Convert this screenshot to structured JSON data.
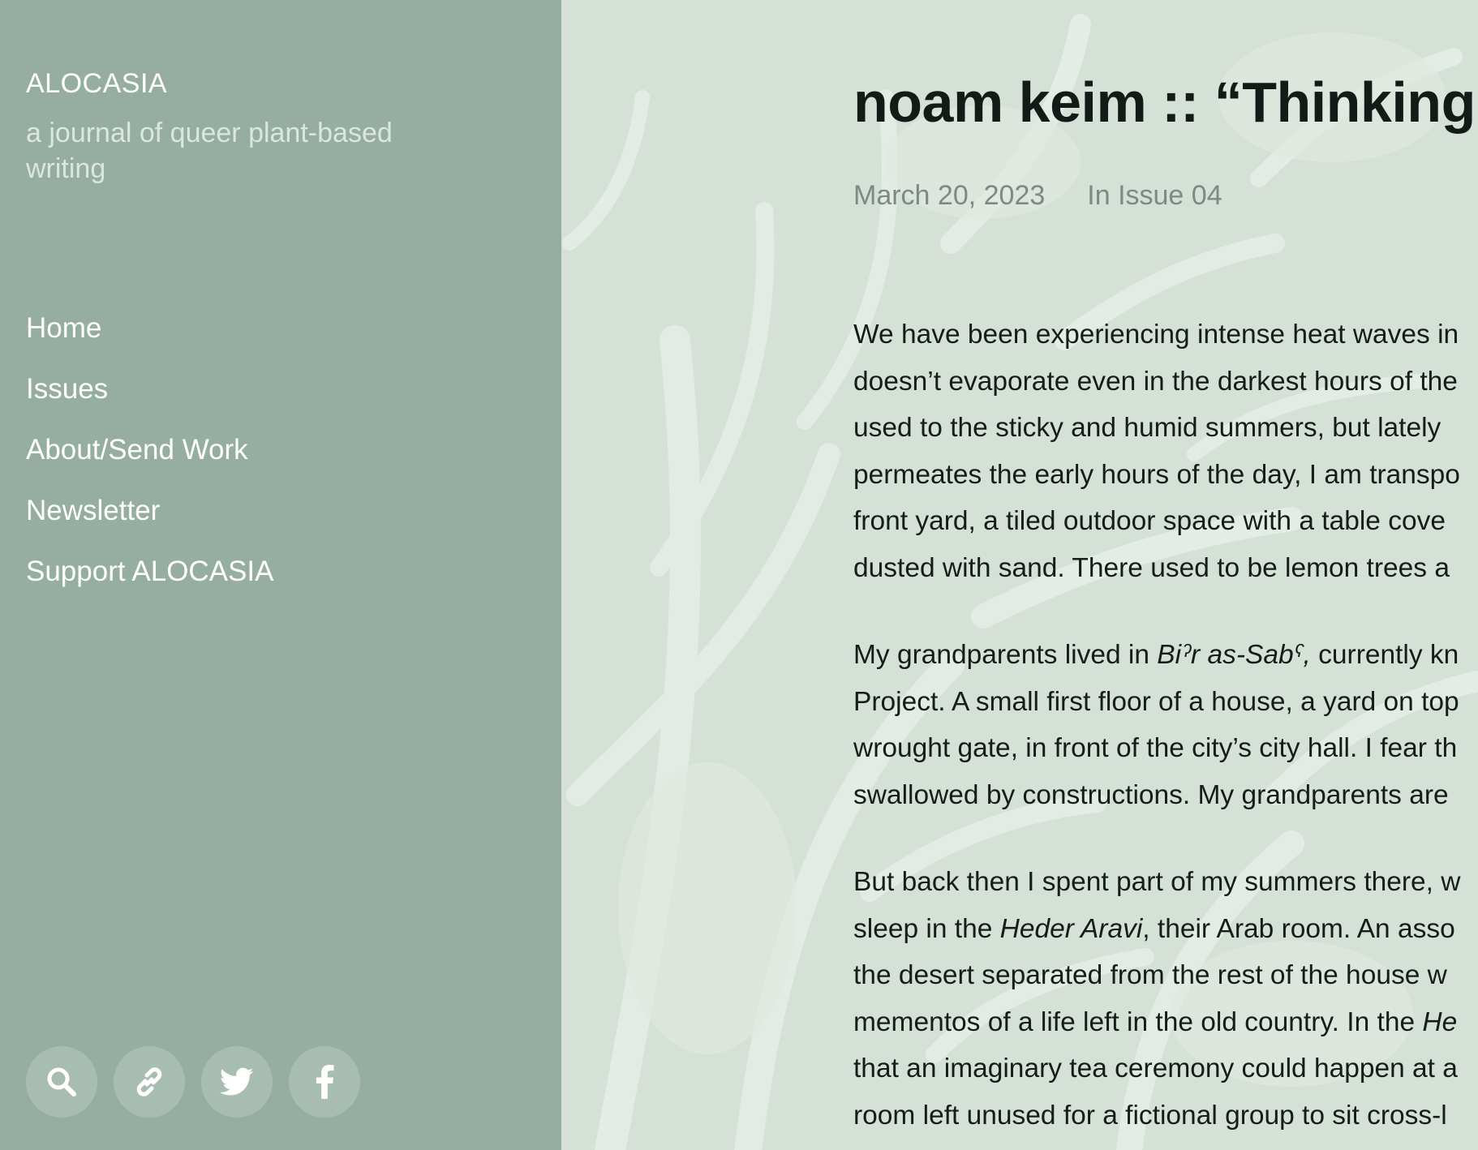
{
  "site": {
    "title": "ALOCASIA",
    "tagline": "a journal of queer plant-based writing"
  },
  "nav": {
    "items": [
      {
        "label": "Home"
      },
      {
        "label": "Issues"
      },
      {
        "label": "About/Send Work"
      },
      {
        "label": "Newsletter"
      },
      {
        "label": "Support ALOCASIA"
      }
    ]
  },
  "social": {
    "icons": [
      "search-icon",
      "link-icon",
      "twitter-icon",
      "facebook-icon"
    ]
  },
  "post": {
    "title": "noam keim :: “Thinking a",
    "date": "March 20, 2023",
    "issue": "In Issue 04",
    "p1": [
      "We have been experiencing intense heat waves in",
      "doesn’t evaporate even in the darkest hours of the",
      "used to the sticky and humid summers, but lately",
      "permeates the early hours of the day, I am transpo",
      "front yard, a tiled outdoor space with a table cove",
      "dusted with sand. There used to be lemon trees a"
    ],
    "p2": {
      "l1_a": "My grandparents lived in ",
      "l1_i": "Biˀr as-Sabˁ,",
      "l1_b": " currently kn",
      "rest": [
        "Project. A small first floor of a house, a yard on top",
        "wrought gate, in front of the city’s city hall. I fear th",
        "swallowed by constructions. My grandparents are"
      ]
    },
    "p3": {
      "l1": "But back then I spent part of my summers there, w",
      "l2_a": "sleep in the ",
      "l2_i": "Heder Aravi",
      "l2_b": ", their Arab room. An asso",
      "l3": "the desert separated from the rest of the house w",
      "l4_a": "mementos of a life left in the old country. In the ",
      "l4_i": "He",
      "l5": "that an imaginary tea ceremony could happen at a",
      "l6": "room left unused for a fictional group to sit cross-l"
    }
  },
  "colors": {
    "sidebar": "#95aea1",
    "main_bg": "#d5e0d6",
    "text": "#161c19",
    "meta": "#7d8a83"
  }
}
